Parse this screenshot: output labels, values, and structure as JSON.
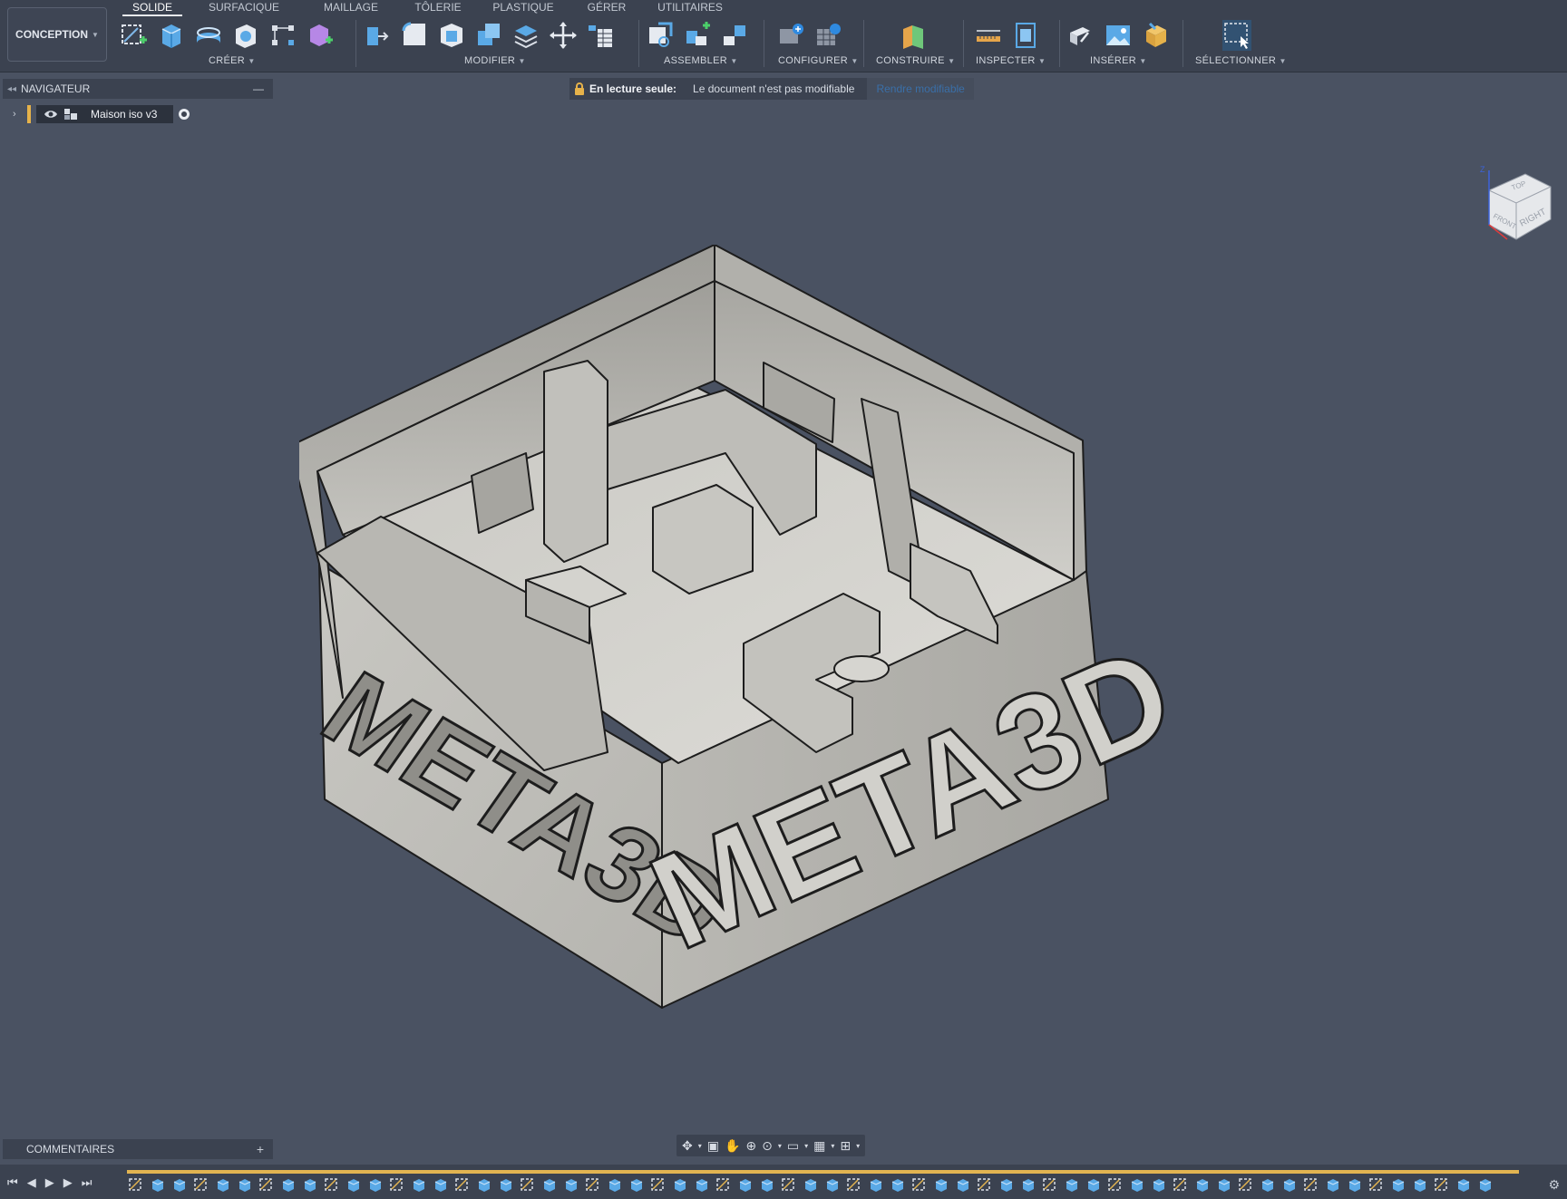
{
  "workspace": {
    "label": "CONCEPTION"
  },
  "tabs": [
    "SOLIDE",
    "SURFACIQUE",
    "MAILLAGE",
    "TÔLERIE",
    "PLASTIQUE",
    "GÉRER",
    "UTILITAIRES"
  ],
  "groups": {
    "creer": "CRÉER",
    "modifier": "MODIFIER",
    "assembler": "ASSEMBLER",
    "configurer": "CONFIGURER",
    "construire": "CONSTRUIRE",
    "inspecter": "INSPECTER",
    "inserer": "INSÉRER",
    "selectionner": "SÉLECTIONNER"
  },
  "navigator": {
    "title": "NAVIGATEUR",
    "document": "Maison iso v3"
  },
  "banner": {
    "title": "En lecture seule:",
    "message": "Le document n'est pas modifiable",
    "action": "Rendre modifiable"
  },
  "model": {
    "front_text": "META3D",
    "right_text": "META3D"
  },
  "viewcube": {
    "face_right": "RIGHT",
    "face_front": "FRONT",
    "face_top": "TOP",
    "axis_z": "Z"
  },
  "comments": {
    "title": "COMMENTAIRES"
  },
  "colors": {
    "accent": "#e2b451",
    "toolbar": "#3b4250",
    "viewport": "#4a5262"
  }
}
